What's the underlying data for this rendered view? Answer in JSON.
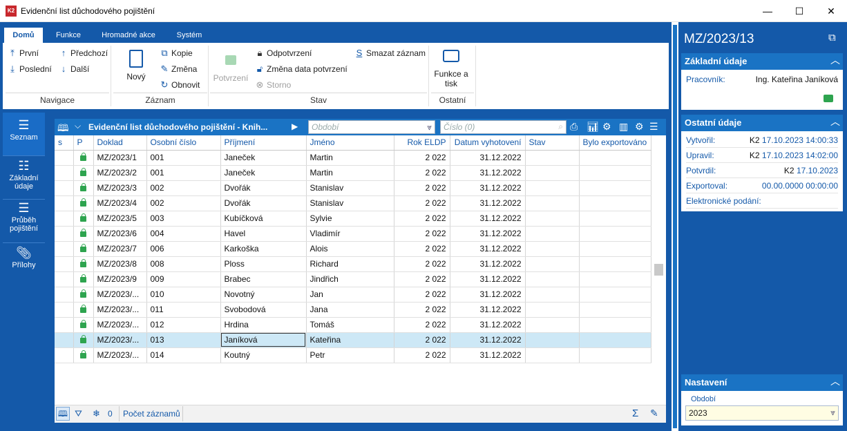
{
  "window": {
    "title": "Evidenční list důchodového pojištění",
    "app_badge": "K2",
    "controls": {
      "minimize": "—",
      "maximize": "☐",
      "close": "✕"
    }
  },
  "ribbon": {
    "tabs": [
      "Domů",
      "Funkce",
      "Hromadné akce",
      "Systém"
    ],
    "active_tab": "Domů",
    "navigace": {
      "prvni": "První",
      "posledni": "Poslední",
      "predchozi": "Předchozí",
      "dalsi": "Další",
      "label": "Navigace"
    },
    "zaznam": {
      "novy": "Nový",
      "kopie": "Kopie",
      "zmena": "Změna",
      "obnovit": "Obnovit",
      "label": "Záznam"
    },
    "stav": {
      "potvrzeni": "Potvrzení",
      "odpotvrzeni": "Odpotvrzení",
      "zmena_data": "Změna data potvrzení",
      "storno": "Storno",
      "smazat": "Smazat záznam",
      "label": "Stav"
    },
    "ostatni": {
      "funkce_tisk_1": "Funkce a",
      "funkce_tisk_2": "tisk",
      "label": "Ostatní"
    }
  },
  "leftnav": {
    "items": [
      {
        "label1": "Seznam",
        "label2": ""
      },
      {
        "label1": "Základní",
        "label2": "údaje"
      },
      {
        "label1": "Průběh",
        "label2": "pojištění"
      },
      {
        "label1": "Přílohy",
        "label2": ""
      }
    ],
    "active": "Seznam"
  },
  "grid": {
    "title": "Evidenční list důchodového pojištění - Knih...",
    "period_placeholder": "Období",
    "number_placeholder": "Číslo (0)",
    "columns": [
      "s",
      "P",
      "Doklad",
      "Osobní číslo",
      "Příjmení",
      "Jméno",
      "Rok ELDP",
      "Datum vyhotovení",
      "Stav",
      "Bylo exportováno"
    ],
    "rows": [
      [
        "MZ/2023/1",
        "001",
        "Janeček",
        "Martin",
        "2 022",
        "31.12.2022"
      ],
      [
        "MZ/2023/2",
        "001",
        "Janeček",
        "Martin",
        "2 022",
        "31.12.2022"
      ],
      [
        "MZ/2023/3",
        "002",
        "Dvořák",
        "Stanislav",
        "2 022",
        "31.12.2022"
      ],
      [
        "MZ/2023/4",
        "002",
        "Dvořák",
        "Stanislav",
        "2 022",
        "31.12.2022"
      ],
      [
        "MZ/2023/5",
        "003",
        "Kubíčková",
        "Sylvie",
        "2 022",
        "31.12.2022"
      ],
      [
        "MZ/2023/6",
        "004",
        "Havel",
        "Vladimír",
        "2 022",
        "31.12.2022"
      ],
      [
        "MZ/2023/7",
        "006",
        "Karkoška",
        "Alois",
        "2 022",
        "31.12.2022"
      ],
      [
        "MZ/2023/8",
        "008",
        "Ploss",
        "Richard",
        "2 022",
        "31.12.2022"
      ],
      [
        "MZ/2023/9",
        "009",
        "Brabec",
        "Jindřich",
        "2 022",
        "31.12.2022"
      ],
      [
        "MZ/2023/...",
        "010",
        "Novotný",
        "Jan",
        "2 022",
        "31.12.2022"
      ],
      [
        "MZ/2023/...",
        "011",
        "Svobodová",
        "Jana",
        "2 022",
        "31.12.2022"
      ],
      [
        "MZ/2023/...",
        "012",
        "Hrdina",
        "Tomáš",
        "2 022",
        "31.12.2022"
      ],
      [
        "MZ/2023/...",
        "013",
        "Janíková",
        "Kateřina",
        "2 022",
        "31.12.2022"
      ],
      [
        "MZ/2023/...",
        "014",
        "Koutný",
        "Petr",
        "2 022",
        "31.12.2022"
      ]
    ],
    "selected_row": 12,
    "status": {
      "filter_count": "0",
      "record_count_label": "Počet záznamů"
    }
  },
  "right_panel": {
    "title": "MZ/2023/13",
    "zakladni": {
      "header": "Základní údaje",
      "pracovnik_label": "Pracovník:",
      "pracovnik_value": "Ing. Kateřina Janíková"
    },
    "ostatni": {
      "header": "Ostatní údaje",
      "vytvoril_label": "Vytvořil:",
      "vytvoril_user": "K2",
      "vytvoril_value": "17.10.2023 14:00:33",
      "upravil_label": "Upravil:",
      "upravil_user": "K2",
      "upravil_value": "17.10.2023 14:02:00",
      "potvrdil_label": "Potvrdil:",
      "potvrdil_user": "K2",
      "potvrdil_value": "17.10.2023",
      "exportoval_label": "Exportoval:",
      "exportoval_value": "00.00.0000 00:00:00",
      "elektronicke_label": "Elektronické podání:"
    },
    "nastaveni": {
      "header": "Nastavení",
      "obdobi_label": "Období",
      "obdobi_value": "2023"
    }
  },
  "colors": {
    "frame_blue": "#1459a9",
    "header_blue": "#1a73c4",
    "selected_row": "#cde8f6",
    "lock_green": "#2ea44f"
  }
}
